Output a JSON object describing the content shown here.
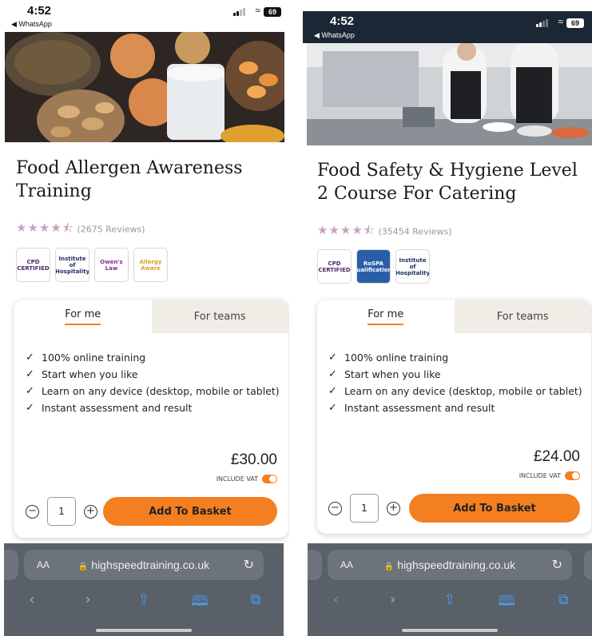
{
  "left": {
    "status": {
      "time": "4:52",
      "back_label": "◀ WhatsApp",
      "battery": "69"
    },
    "product": {
      "title": "Food Allergen Awareness Training",
      "review_count": "(2675 Reviews)",
      "rating": 4.5,
      "badges": [
        "CPD CERTIFIED",
        "Institute of Hospitality",
        "Owen's Law",
        "Allergy Aware"
      ]
    },
    "tabs": {
      "for_me": "For me",
      "for_teams": "For teams"
    },
    "features": [
      "100% online training",
      "Start when you like",
      "Learn on any device (desktop, mobile or tablet)",
      "Instant assessment and result"
    ],
    "price": "£30.00",
    "vat_label": "INCLUDE VAT",
    "quantity": "1",
    "basket_label": "Add To Basket",
    "browser": {
      "aa": "AA",
      "url": "highspeedtraining.co.uk"
    }
  },
  "right": {
    "status": {
      "time": "4:52",
      "back_label": "◀ WhatsApp",
      "battery": "69"
    },
    "product": {
      "title": "Food Safety & Hygiene Level 2 Course For Catering",
      "review_count": "(35454 Reviews)",
      "rating": 4.5,
      "badges": [
        "CPD CERTIFIED",
        "RoSPA Qualifications",
        "Institute of Hospitality"
      ]
    },
    "tabs": {
      "for_me": "For me",
      "for_teams": "For teams"
    },
    "features": [
      "100% online training",
      "Start when you like",
      "Learn on any device (desktop, mobile or tablet)",
      "Instant assessment and result"
    ],
    "price": "£24.00",
    "vat_label": "INCLUDE VAT",
    "quantity": "1",
    "basket_label": "Add To Basket",
    "browser": {
      "aa": "AA",
      "url": "highspeedtraining.co.uk"
    }
  },
  "colors": {
    "accent": "#f47f20",
    "star": "#c7a2c3",
    "tab_inactive": "#f0ede6"
  },
  "icons": [
    "check-icon",
    "minus-icon",
    "plus-icon",
    "lock-icon",
    "reload-icon",
    "back-icon",
    "forward-icon",
    "share-icon",
    "bookmarks-icon",
    "tabs-icon"
  ]
}
